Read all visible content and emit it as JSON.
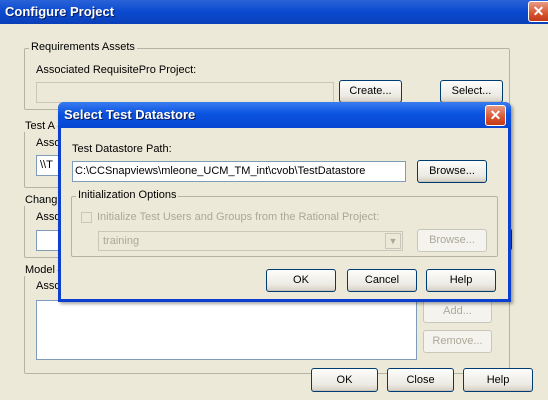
{
  "window": {
    "title": "Configure Project",
    "requirements": {
      "legend": "Requirements Assets",
      "label": "Associated RequisitePro Project:",
      "create_label": "Create...",
      "select_label": "Select..."
    },
    "test_assets": {
      "legend_partial": "Test A",
      "label_partial": "Asso",
      "value_partial": "\\\\T"
    },
    "change": {
      "legend_partial": "Chang",
      "label_partial": "Asso"
    },
    "models": {
      "legend_partial": "Model",
      "label_partial": "Asso",
      "add_label": "Add...",
      "remove_label": "Remove..."
    },
    "footer": {
      "ok_label": "OK",
      "close_label": "Close",
      "help_label": "Help"
    }
  },
  "dialog": {
    "title": "Select Test Datastore",
    "path_label": "Test Datastore Path:",
    "path_value": "C:\\CCSnapviews\\mleone_UCM_TM_int\\cvob\\TestDatastore",
    "browse_label": "Browse...",
    "init": {
      "legend": "Initialization Options",
      "checkbox_label": "Initialize Test Users and Groups from the Rational Project:",
      "project_value": "training",
      "browse_label": "Browse..."
    },
    "ok_label": "OK",
    "cancel_label": "Cancel",
    "help_label": "Help"
  }
}
